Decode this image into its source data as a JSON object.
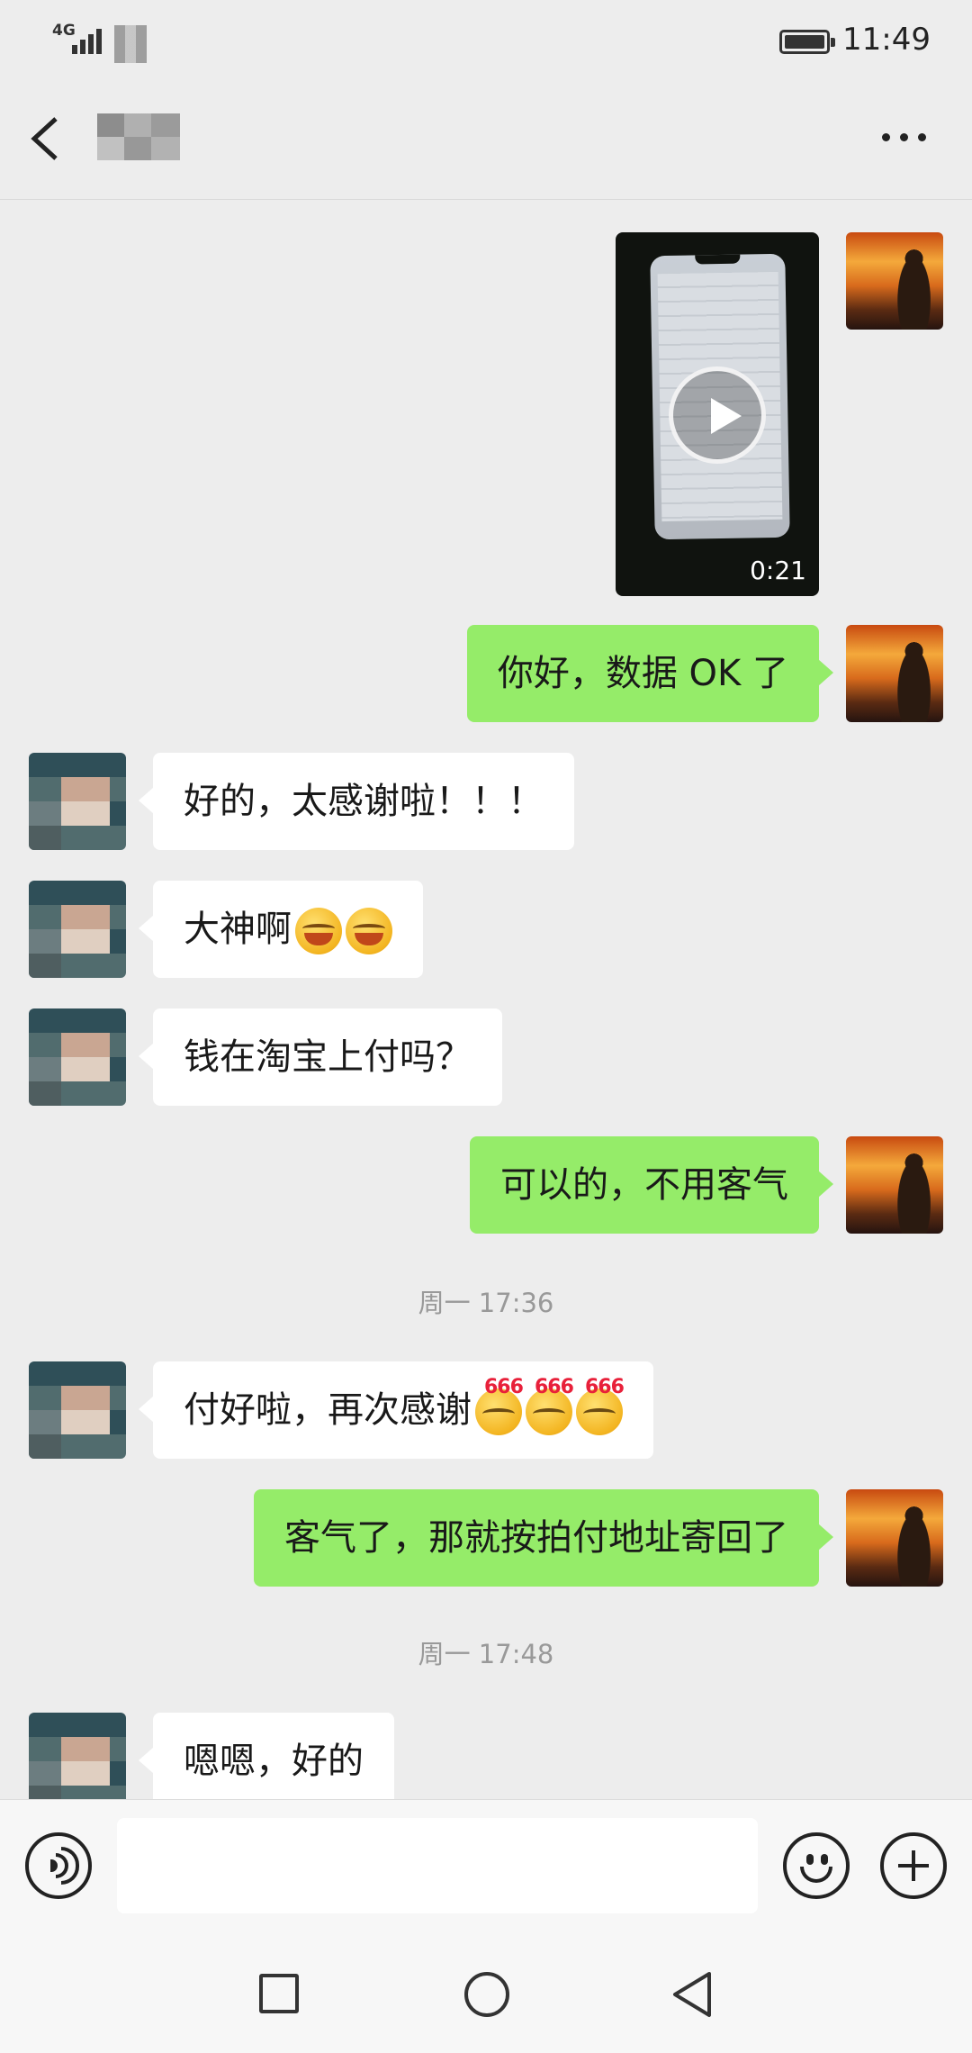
{
  "status_bar": {
    "network": "4G",
    "time": "11:49"
  },
  "header": {
    "title": "",
    "back_icon": "back-arrow-icon",
    "more_icon": "more-dots-icon"
  },
  "messages": [
    {
      "side": "me",
      "type": "video",
      "duration": "0:21"
    },
    {
      "side": "me",
      "type": "text",
      "text": "你好，数据 OK 了"
    },
    {
      "side": "other",
      "type": "text",
      "text": "好的，太感谢啦！！！"
    },
    {
      "side": "other",
      "type": "text",
      "text": "大神啊",
      "emoji": [
        "hugging-face-emoji",
        "hugging-face-emoji"
      ]
    },
    {
      "side": "other",
      "type": "text",
      "text": "钱在淘宝上付吗？"
    },
    {
      "side": "me",
      "type": "text",
      "text": "可以的，不用客气"
    },
    {
      "side": "system",
      "type": "time",
      "text": "周一 17:36"
    },
    {
      "side": "other",
      "type": "text",
      "text": "付好啦，再次感谢",
      "emoji": [
        "666-emoji",
        "666-emoji",
        "666-emoji"
      ]
    },
    {
      "side": "me",
      "type": "text",
      "text": "客气了，那就按拍付地址寄回了"
    },
    {
      "side": "system",
      "type": "time",
      "text": "周一 17:48"
    },
    {
      "side": "other",
      "type": "text",
      "text": "嗯嗯，好的"
    }
  ],
  "input_bar": {
    "value": "",
    "voice_icon": "voice-icon",
    "emoji_icon": "emoji-icon",
    "plus_icon": "plus-icon"
  },
  "nav_bar": {
    "recents_icon": "square-icon",
    "home_icon": "circle-icon",
    "back_icon": "triangle-back-icon"
  },
  "colors": {
    "background": "#ededed",
    "my_bubble": "#95ec69",
    "their_bubble": "#ffffff",
    "timestamp": "#999999"
  }
}
